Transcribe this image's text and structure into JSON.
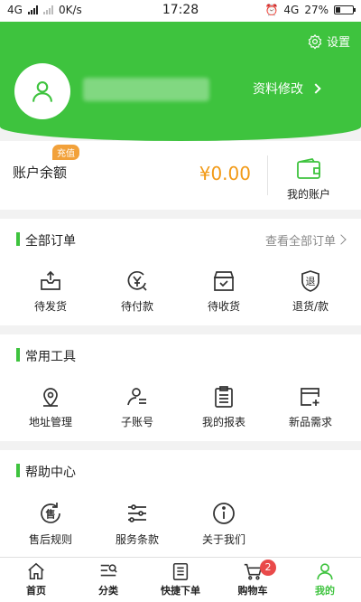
{
  "status": {
    "network1": "4G",
    "speed": "0K/s",
    "time": "17:28",
    "network2": "4G",
    "battery": "27%"
  },
  "header": {
    "settings_label": "设置",
    "edit_label": "资料修改"
  },
  "balance": {
    "badge": "充值",
    "label": "账户余额",
    "value": "¥0.00",
    "account_label": "我的账户"
  },
  "orders": {
    "title": "全部订单",
    "more": "查看全部订单",
    "items": [
      {
        "label": "待发货",
        "icon": "box-out-icon"
      },
      {
        "label": "待付款",
        "icon": "yen-clock-icon"
      },
      {
        "label": "待收货",
        "icon": "package-check-icon"
      },
      {
        "label": "退货/款",
        "icon": "return-shield-icon"
      }
    ]
  },
  "tools": {
    "title": "常用工具",
    "items": [
      {
        "label": "地址管理",
        "icon": "location-icon"
      },
      {
        "label": "子账号",
        "icon": "sub-account-icon"
      },
      {
        "label": "我的报表",
        "icon": "report-icon"
      },
      {
        "label": "新品需求",
        "icon": "new-product-icon"
      }
    ]
  },
  "help": {
    "title": "帮助中心",
    "items": [
      {
        "label": "售后规则",
        "icon": "after-sale-icon"
      },
      {
        "label": "服务条款",
        "icon": "terms-icon"
      },
      {
        "label": "关于我们",
        "icon": "info-icon"
      }
    ]
  },
  "tabbar": {
    "items": [
      {
        "label": "首页",
        "icon": "home-icon"
      },
      {
        "label": "分类",
        "icon": "category-icon"
      },
      {
        "label": "快捷下单",
        "icon": "quick-order-icon"
      },
      {
        "label": "购物车",
        "icon": "cart-icon",
        "badge": "2"
      },
      {
        "label": "我的",
        "icon": "profile-icon",
        "active": true
      }
    ]
  },
  "colors": {
    "brand_green": "#3ec33e",
    "balance_orange": "#f29a17",
    "badge_red": "#e94a4a"
  }
}
